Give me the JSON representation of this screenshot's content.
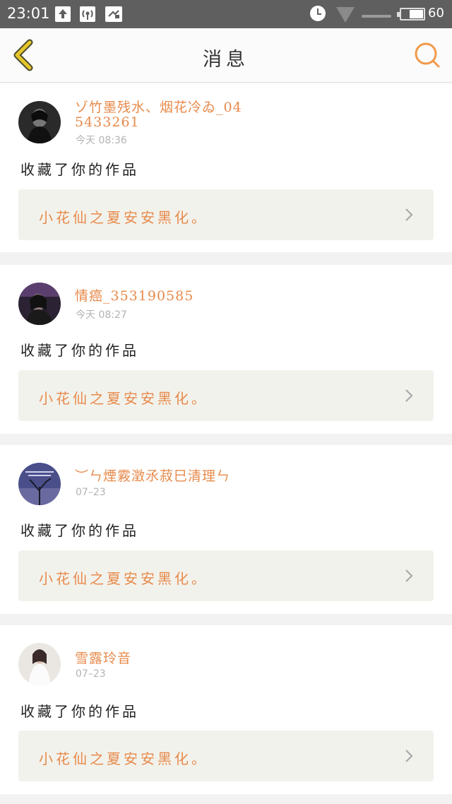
{
  "status_bar": {
    "time": "23:01",
    "battery_level": "60",
    "battery_fill_fraction": 0.6,
    "icons": [
      "upload-icon",
      "hotspot-icon",
      "screenshot-icon",
      "alarm-icon",
      "wifi-icon",
      "signal-icon",
      "battery-icon"
    ]
  },
  "header": {
    "title": "消息",
    "back_icon": "chevron-left-icon",
    "search_icon": "search-icon"
  },
  "colors": {
    "accent": "#e78a4b",
    "back_icon": "#e6c52b",
    "card_box": "#f2f2ec",
    "background": "#f2f2f2"
  },
  "notifications": [
    {
      "username": "ゾ竹墨残水、烟花冷ゐ_045433261",
      "time": "今天  08:36",
      "action": "收藏了你的作品",
      "work_title": "小花仙之夏安安黑化。"
    },
    {
      "username": "情癌_353190585",
      "time": "今天  08:27",
      "action": "收藏了你的作品",
      "work_title": "小花仙之夏安安黑化。"
    },
    {
      "username": "︶ㄣ煙霚澂氶菽巳清理ㄣ",
      "time": "07–23",
      "action": "收藏了你的作品",
      "work_title": "小花仙之夏安安黑化。"
    },
    {
      "username": "雪露玲音",
      "time": "07–23",
      "action": "收藏了你的作品",
      "work_title": "小花仙之夏安安黑化。"
    }
  ]
}
